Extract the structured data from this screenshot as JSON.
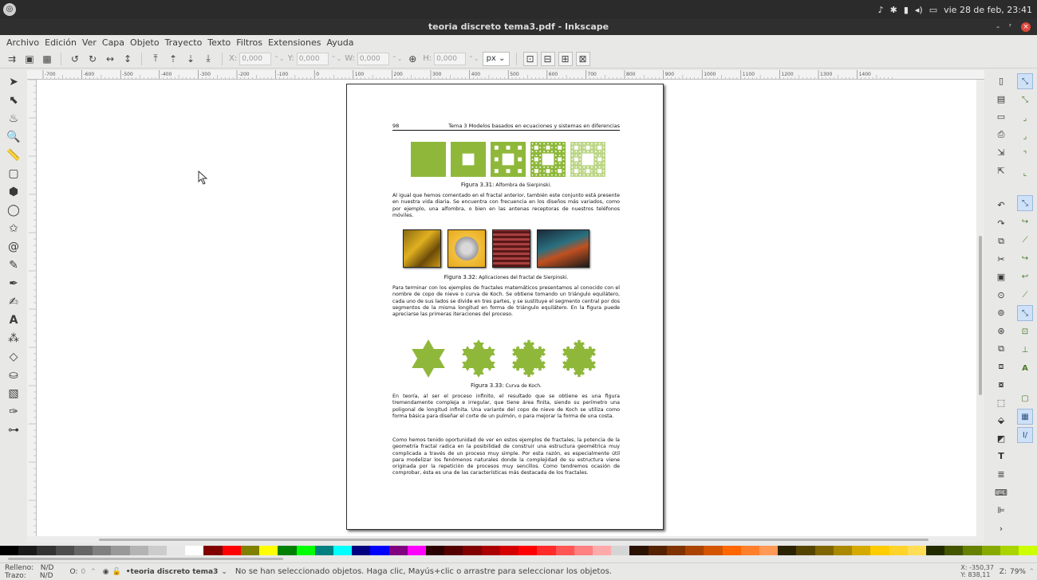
{
  "topbar": {
    "logo_icon": "ubuntu-logo-icon",
    "clock": "vie 28 de feb, 23:41"
  },
  "window": {
    "title": "teoria discreto tema3.pdf - Inkscape",
    "min": "-",
    "max": "ʳ",
    "close": "×"
  },
  "menu": [
    "Archivo",
    "Edición",
    "Ver",
    "Capa",
    "Objeto",
    "Trayecto",
    "Texto",
    "Filtros",
    "Extensiones",
    "Ayuda"
  ],
  "toolbar": {
    "x_label": "X:",
    "x_value": "0,000",
    "y_label": "Y:",
    "y_value": "0,000",
    "w_label": "W:",
    "w_value": "0,000",
    "h_label": "H:",
    "h_value": "0,000",
    "unit": "px"
  },
  "ruler": {
    "h_ticks": [
      "-700",
      "-600",
      "-500",
      "-400",
      "-300",
      "-200",
      "-100",
      "0",
      "100",
      "200",
      "300",
      "400",
      "500",
      "600",
      "700",
      "800",
      "900",
      "1000",
      "1100",
      "1200",
      "1300",
      "1400"
    ]
  },
  "document": {
    "page_number": "98",
    "running_head": "Tema 3 Modelos basados en ecuaciones y sistemas en diferencias",
    "fig31_label": "Figura 3.31:",
    "fig31_caption": "Alfombra de Sierpinski.",
    "para1": "Al igual que hemos comentado en el fractal anterior, también este conjunto está presente en nuestra vida diaria. Se encuentra con frecuencia en los diseños más variados, como por ejemplo, una alfombra, o bien en las antenas receptoras de nuestros teléfonos móviles.",
    "fig32_label": "Figura 3.32:",
    "fig32_caption": "Aplicaciones del fractal de Sierpinski.",
    "para2": "Para terminar con los ejemplos de fractales matemáticos presentamos al conocido con el nombre de copo de nieve o curva de Koch. Se obtiene tomando un triángulo equilátero, cada uno de sus lados se divide en tres partes, y se sustituye el segmento central por dos segmentos de la misma longitud en forma de triángulo equilátero. En la figura puede apreciarse las primeras iteraciones del proceso.",
    "fig33_label": "Figura 3.33:",
    "fig33_caption": "Curva de Koch.",
    "para3": "En teoría, al ser el proceso infinito, el resultado que se obtiene es una figura tremendamente compleja e irregular, que tiene área finita, siendo su perímetro una poligonal de longitud infinita. Una variante del copo de nieve de Koch se utiliza como forma básica para diseñar el corte de un pulmón, o para mejorar la forma de una costa.",
    "para4": "Como hemos tenido oportunidad de ver en estos ejemplos de fractales, la potencia de la geometría fractal radica en la posibilidad de construir una estructura geométrica muy complicada a través de un proceso muy simple. Por esta razón, es especialmente útil para modelizar los fenómenos naturales donde la complejidad de su estructura viene originada por la repetición de procesos muy sencillos. Como tendremos ocasión de comprobar, ésta es una de las características más destacada de los fractales."
  },
  "status": {
    "fill_label": "Relleno:",
    "fill_value": "N/D",
    "stroke_label": "Trazo:",
    "stroke_value": "N/D",
    "opacity_label": "O:",
    "opacity_value": "0",
    "layer": "•teoria discreto tema3",
    "message": "No se han seleccionado objetos. Haga clic, Mayús+clic o arrastre para seleccionar los objetos.",
    "cursor_x": "X: -350,37",
    "cursor_y": "Y: 838,11",
    "zoom_label": "Z:",
    "zoom": "79%"
  },
  "colors": {
    "accent_green": "#8fb83b",
    "palette": [
      "#000000",
      "#1a1a1a",
      "#333333",
      "#4d4d4d",
      "#666666",
      "#808080",
      "#999999",
      "#b3b3b3",
      "#cccccc",
      "#e6e6e6",
      "#ffffff",
      "#800000",
      "#ff0000",
      "#808000",
      "#ffff00",
      "#008000",
      "#00ff00",
      "#008080",
      "#00ffff",
      "#000080",
      "#0000ff",
      "#800080",
      "#ff00ff",
      "#2b0000",
      "#550000",
      "#800000",
      "#aa0000",
      "#d40000",
      "#ff0000",
      "#ff2a2a",
      "#ff5555",
      "#ff8080",
      "#ffaaaa",
      "#d5d5d5",
      "#2b1100",
      "#552200",
      "#803300",
      "#aa4400",
      "#d45500",
      "#ff6600",
      "#ff7f2a",
      "#ff9955",
      "#2b2200",
      "#554400",
      "#806600",
      "#aa8800",
      "#d4aa00",
      "#ffcc00",
      "#ffd42a",
      "#ffdd55",
      "#222b00",
      "#445500",
      "#668000",
      "#88aa00",
      "#aad400",
      "#ccff00"
    ]
  }
}
